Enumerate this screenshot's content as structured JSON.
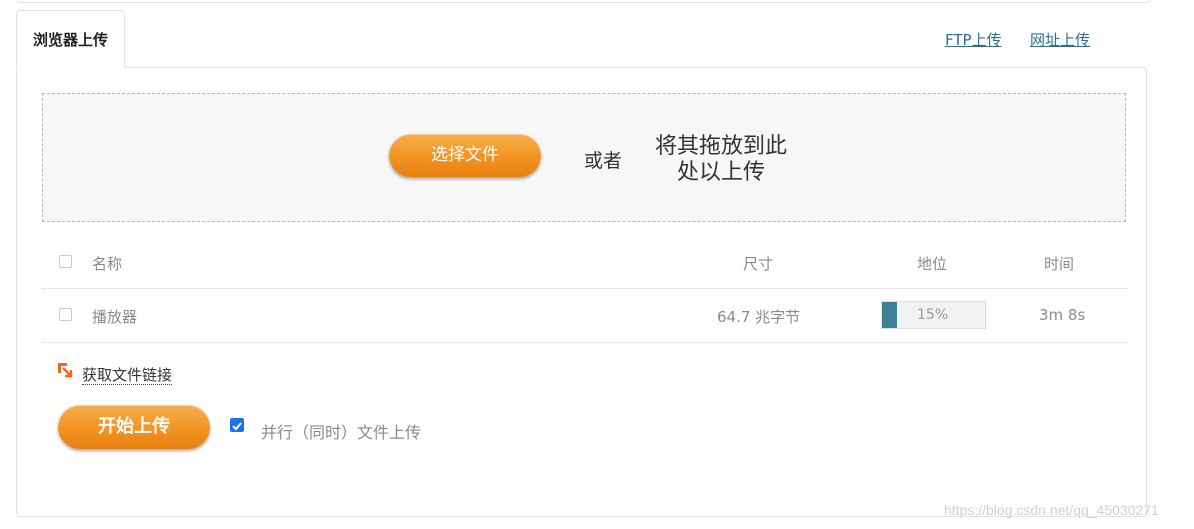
{
  "tabs": {
    "active": "浏览器上传",
    "ftp": "FTP上传",
    "url": "网址上传"
  },
  "dropzone": {
    "select_button": "选择文件",
    "or_text": "或者",
    "drop_line1": "将其拖放到此",
    "drop_line2": "处以上传"
  },
  "table": {
    "headers": {
      "name": "名称",
      "size": "尺寸",
      "status": "地位",
      "time": "时间"
    },
    "rows": [
      {
        "name": "播放器",
        "size": "64.7 兆字节",
        "progress_percent": 15,
        "progress_label": "15%",
        "time": "3m 8s"
      }
    ]
  },
  "actions": {
    "get_link": "获取文件链接",
    "start_upload": "开始上传",
    "parallel_label": "并行（同时）文件上传",
    "parallel_checked": true
  },
  "colors": {
    "accent_orange": "#f29322",
    "link_blue": "#2d6f8c",
    "progress_fill": "#3e7f93",
    "checkbox_blue": "#1a73e8"
  },
  "watermark": "https://blog.csdn.net/qq_45030271"
}
